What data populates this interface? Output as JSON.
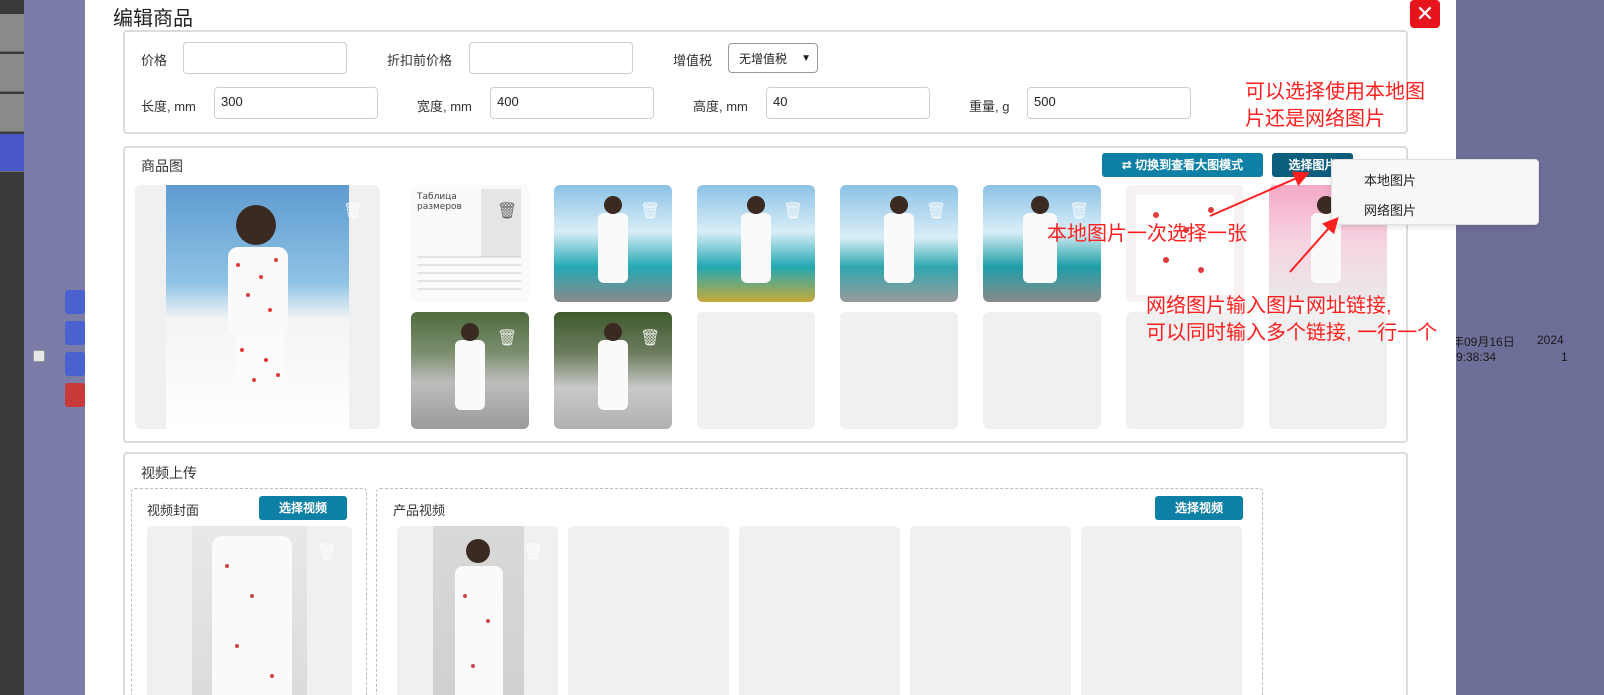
{
  "background": {
    "dates": [
      "年09月16日",
      "9:38:34",
      "2024",
      "1"
    ]
  },
  "modal": {
    "title": "编辑商品",
    "close_icon": "close-icon"
  },
  "form": {
    "price_label": "价格",
    "price_value": "",
    "price_before_discount_label": "折扣前价格",
    "price_before_discount_value": "",
    "vat_label": "增值税",
    "vat_selected": "无增值税",
    "length_label": "长度, mm",
    "length_value": "300",
    "width_label": "宽度, mm",
    "width_value": "400",
    "height_label": "高度, mm",
    "height_value": "40",
    "weight_label": "重量, g",
    "weight_value": "500"
  },
  "product_images": {
    "title": "商品图",
    "toggle_button": "⇄ 切换到查看大图模式",
    "select_button": "选择图片",
    "dropdown_items": [
      "本地图片",
      "网络图片"
    ]
  },
  "video_upload": {
    "title": "视频上传",
    "cover_label": "视频封面",
    "cover_button": "选择视频",
    "product_video_label": "产品视频",
    "product_video_button": "选择视频"
  },
  "annotations": {
    "choose_source": [
      "可以选择使用本地图",
      "片还是网络图片"
    ],
    "local_one_at_a_time": "本地图片一次选择一张",
    "network_links": [
      "网络图片输入图片网址链接,",
      "可以同时输入多个链接, 一行一个"
    ]
  },
  "colors": {
    "accent": "#0e7fa5",
    "close": "#e8141b",
    "annotation": "#ff1f1f"
  }
}
